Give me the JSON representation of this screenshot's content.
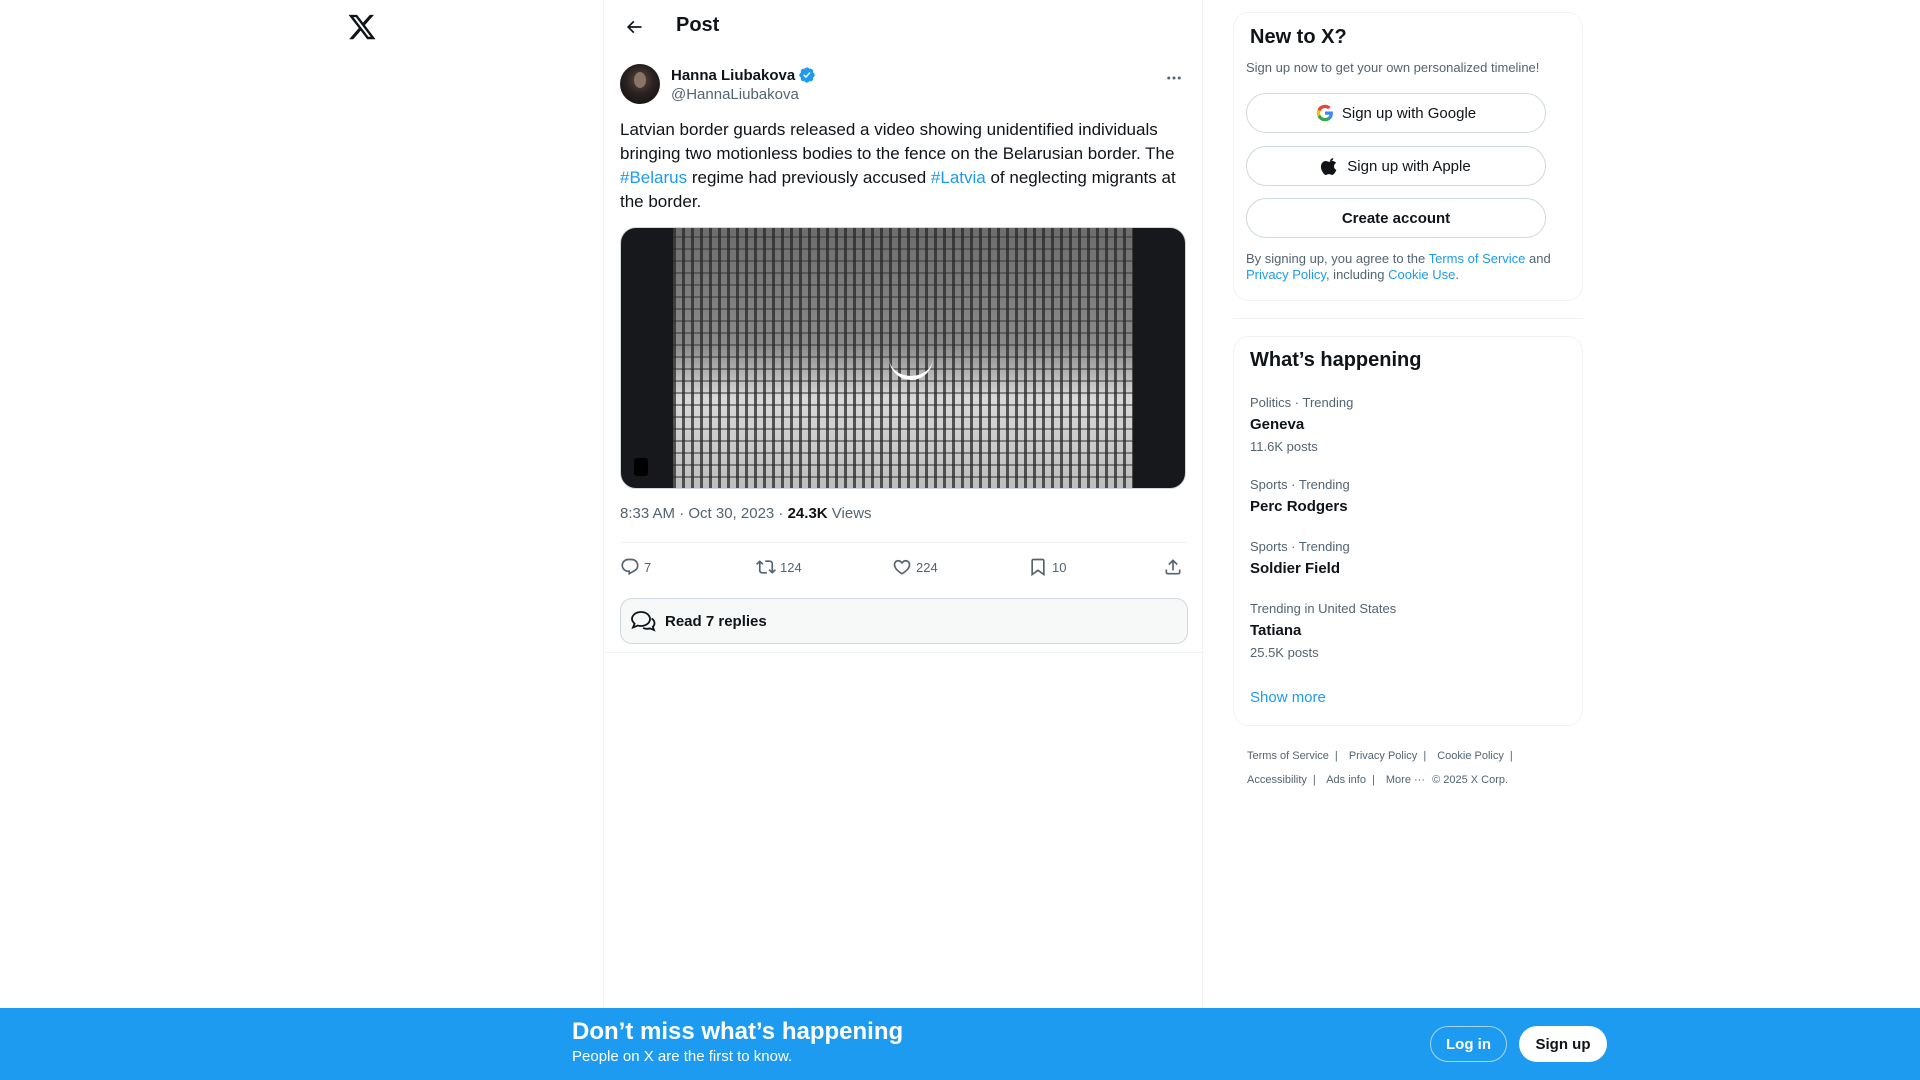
{
  "header": {
    "title": "Post"
  },
  "post": {
    "author_name": "Hanna Liubakova",
    "author_handle": "@HannaLiubakova",
    "text_part1": "Latvian border guards released a video showing unidentified individuals bringing two motionless bodies to the fence on the Belarusian border. The ",
    "hashtag1": "#Belarus",
    "text_part2": " regime had previously accused ",
    "hashtag2": "#Latvia",
    "text_part3": " of neglecting migrants at the border.",
    "time": "8:33 AM · Oct 30, 2023 · ",
    "views_count": "24.3K",
    "views_label": " Views",
    "replies": "7",
    "reposts": "124",
    "likes": "224",
    "bookmarks": "10",
    "read_replies": "Read 7 replies"
  },
  "signup": {
    "title": "New to X?",
    "subtitle": "Sign up now to get your own personalized timeline!",
    "google_label": "Sign up with Google",
    "apple_label": "Sign up with Apple",
    "create_label": "Create account",
    "legal_prefix": "By signing up, you agree to the ",
    "terms": "Terms of Service",
    "and": " and ",
    "privacy": "Privacy Policy",
    "including": ", including ",
    "cookie": "Cookie Use",
    "period": "."
  },
  "trends": {
    "title": "What’s happening",
    "items": [
      {
        "category": "Politics · Trending",
        "name": "Geneva",
        "count": "11.6K posts"
      },
      {
        "category": "Sports · Trending",
        "name": "Perc Rodgers",
        "count": ""
      },
      {
        "category": "Sports · Trending",
        "name": "Soldier Field",
        "count": ""
      },
      {
        "category": "Trending in United States",
        "name": "Tatiana",
        "count": "25.5K posts"
      }
    ],
    "show_more": "Show more"
  },
  "footer": {
    "terms": "Terms of Service",
    "privacy": "Privacy Policy",
    "cookie": "Cookie Policy",
    "accessibility": "Accessibility",
    "ads": "Ads info",
    "more": "More ···",
    "copyright": "© 2025 X Corp.",
    "separator": "|"
  },
  "banner": {
    "title": "Don’t miss what’s happening",
    "subtitle": "People on X are the first to know.",
    "login": "Log in",
    "signup": "Sign up"
  },
  "colors": {
    "accent": "#1d9bf0",
    "text": "#0f1419",
    "muted": "#536471",
    "border": "#eff3f4"
  },
  "icons": [
    "x-logo-icon",
    "back-arrow-icon",
    "verified-badge-icon",
    "more-icon",
    "reply-icon",
    "repost-icon",
    "like-icon",
    "bookmark-icon",
    "share-icon",
    "replies-bubble-icon",
    "google-icon",
    "apple-icon"
  ]
}
